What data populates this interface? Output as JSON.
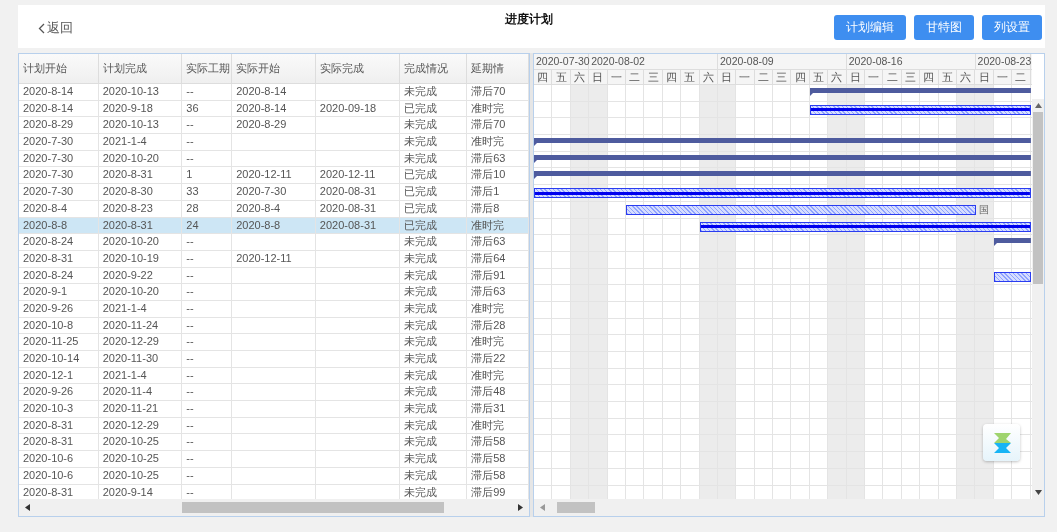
{
  "header": {
    "back": "返回",
    "title": "进度计划",
    "buttons": [
      "计划编辑",
      "甘特图",
      "列设置"
    ]
  },
  "table": {
    "columns": [
      "计划开始",
      "计划完成",
      "实际工期",
      "实际开始",
      "实际完成",
      "完成情况",
      "延期情"
    ],
    "rows": [
      {
        "cells": [
          "2020-8-14",
          "2020-10-13",
          "--",
          "2020-8-14",
          "",
          "未完成",
          "滞后70"
        ],
        "selected": false,
        "bar": {
          "kind": "plan"
        }
      },
      {
        "cells": [
          "2020-8-14",
          "2020-9-18",
          "36",
          "2020-8-14",
          "2020-09-18",
          "已完成",
          "准时完"
        ],
        "selected": false,
        "bar": {
          "kind": "actual"
        }
      },
      {
        "cells": [
          "2020-8-29",
          "2020-10-13",
          "--",
          "2020-8-29",
          "",
          "未完成",
          "滞后70"
        ],
        "selected": false
      },
      {
        "cells": [
          "2020-7-30",
          "2021-1-4",
          "--",
          "",
          "",
          "未完成",
          "准时完"
        ],
        "selected": false,
        "bar": {
          "kind": "plan"
        }
      },
      {
        "cells": [
          "2020-7-30",
          "2020-10-20",
          "--",
          "",
          "",
          "未完成",
          "滞后63"
        ],
        "selected": false,
        "bar": {
          "kind": "plan"
        }
      },
      {
        "cells": [
          "2020-7-30",
          "2020-8-31",
          "1",
          "2020-12-11",
          "2020-12-11",
          "已完成",
          "滞后10"
        ],
        "selected": false,
        "bar": {
          "kind": "plan"
        }
      },
      {
        "cells": [
          "2020-7-30",
          "2020-8-30",
          "33",
          "2020-7-30",
          "2020-08-31",
          "已完成",
          "滞后1"
        ],
        "selected": false,
        "bar": {
          "kind": "actual"
        }
      },
      {
        "cells": [
          "2020-8-4",
          "2020-8-23",
          "28",
          "2020-8-4",
          "2020-08-31",
          "已完成",
          "滞后8"
        ],
        "selected": false,
        "bar": {
          "kind": "hatched",
          "label": "国"
        }
      },
      {
        "cells": [
          "2020-8-8",
          "2020-8-31",
          "24",
          "2020-8-8",
          "2020-08-31",
          "已完成",
          "准时完"
        ],
        "selected": true,
        "bar": {
          "kind": "actual"
        }
      },
      {
        "cells": [
          "2020-8-24",
          "2020-10-20",
          "--",
          "",
          "",
          "未完成",
          "滞后63"
        ],
        "selected": false,
        "bar": {
          "kind": "plan"
        }
      },
      {
        "cells": [
          "2020-8-31",
          "2020-10-19",
          "--",
          "2020-12-11",
          "",
          "未完成",
          "滞后64"
        ],
        "selected": false
      },
      {
        "cells": [
          "2020-8-24",
          "2020-9-22",
          "--",
          "",
          "",
          "未完成",
          "滞后91"
        ],
        "selected": false,
        "bar": {
          "kind": "hatched"
        }
      },
      {
        "cells": [
          "2020-9-1",
          "2020-10-20",
          "--",
          "",
          "",
          "未完成",
          "滞后63"
        ],
        "selected": false
      },
      {
        "cells": [
          "2020-9-26",
          "2021-1-4",
          "--",
          "",
          "",
          "未完成",
          "准时完"
        ],
        "selected": false
      },
      {
        "cells": [
          "2020-10-8",
          "2020-11-24",
          "--",
          "",
          "",
          "未完成",
          "滞后28"
        ],
        "selected": false
      },
      {
        "cells": [
          "2020-11-25",
          "2020-12-29",
          "--",
          "",
          "",
          "未完成",
          "准时完"
        ],
        "selected": false
      },
      {
        "cells": [
          "2020-10-14",
          "2020-11-30",
          "--",
          "",
          "",
          "未完成",
          "滞后22"
        ],
        "selected": false
      },
      {
        "cells": [
          "2020-12-1",
          "2021-1-4",
          "--",
          "",
          "",
          "未完成",
          "准时完"
        ],
        "selected": false
      },
      {
        "cells": [
          "2020-9-26",
          "2020-11-4",
          "--",
          "",
          "",
          "未完成",
          "滞后48"
        ],
        "selected": false
      },
      {
        "cells": [
          "2020-10-3",
          "2020-11-21",
          "--",
          "",
          "",
          "未完成",
          "滞后31"
        ],
        "selected": false
      },
      {
        "cells": [
          "2020-8-31",
          "2020-12-29",
          "--",
          "",
          "",
          "未完成",
          "准时完"
        ],
        "selected": false
      },
      {
        "cells": [
          "2020-8-31",
          "2020-10-25",
          "--",
          "",
          "",
          "未完成",
          "滞后58"
        ],
        "selected": false
      },
      {
        "cells": [
          "2020-10-6",
          "2020-10-25",
          "--",
          "",
          "",
          "未完成",
          "滞后58"
        ],
        "selected": false
      },
      {
        "cells": [
          "2020-10-6",
          "2020-10-25",
          "--",
          "",
          "",
          "未完成",
          "滞后58"
        ],
        "selected": false
      },
      {
        "cells": [
          "2020-8-31",
          "2020-9-14",
          "--",
          "",
          "",
          "未完成",
          "滞后99"
        ],
        "selected": false
      }
    ]
  },
  "gantt": {
    "weeks": [
      {
        "label": "2020-07-30"
      },
      {
        "label": "2020-08-02"
      },
      {
        "label": "2020-08-09"
      },
      {
        "label": "2020-08-16"
      },
      {
        "label": "2020-08-23"
      }
    ],
    "days": [
      {
        "label": "四",
        "weekend": false
      },
      {
        "label": "五",
        "weekend": false
      },
      {
        "label": "六",
        "weekend": true
      },
      {
        "label": "日",
        "weekend": true
      },
      {
        "label": "一",
        "weekend": false
      },
      {
        "label": "二",
        "weekend": false
      },
      {
        "label": "三",
        "weekend": false
      },
      {
        "label": "四",
        "weekend": false
      },
      {
        "label": "五",
        "weekend": false
      },
      {
        "label": "六",
        "weekend": true
      },
      {
        "label": "日",
        "weekend": true
      },
      {
        "label": "一",
        "weekend": false
      },
      {
        "label": "二",
        "weekend": false
      },
      {
        "label": "三",
        "weekend": false
      },
      {
        "label": "四",
        "weekend": false
      },
      {
        "label": "五",
        "weekend": false
      },
      {
        "label": "六",
        "weekend": true
      },
      {
        "label": "日",
        "weekend": true
      },
      {
        "label": "一",
        "weekend": false
      },
      {
        "label": "二",
        "weekend": false
      },
      {
        "label": "三",
        "weekend": false
      },
      {
        "label": "四",
        "weekend": false
      },
      {
        "label": "五",
        "weekend": false
      },
      {
        "label": "六",
        "weekend": true
      },
      {
        "label": "日",
        "weekend": true
      },
      {
        "label": "一",
        "weekend": false
      },
      {
        "label": "二",
        "weekend": false
      }
    ]
  }
}
